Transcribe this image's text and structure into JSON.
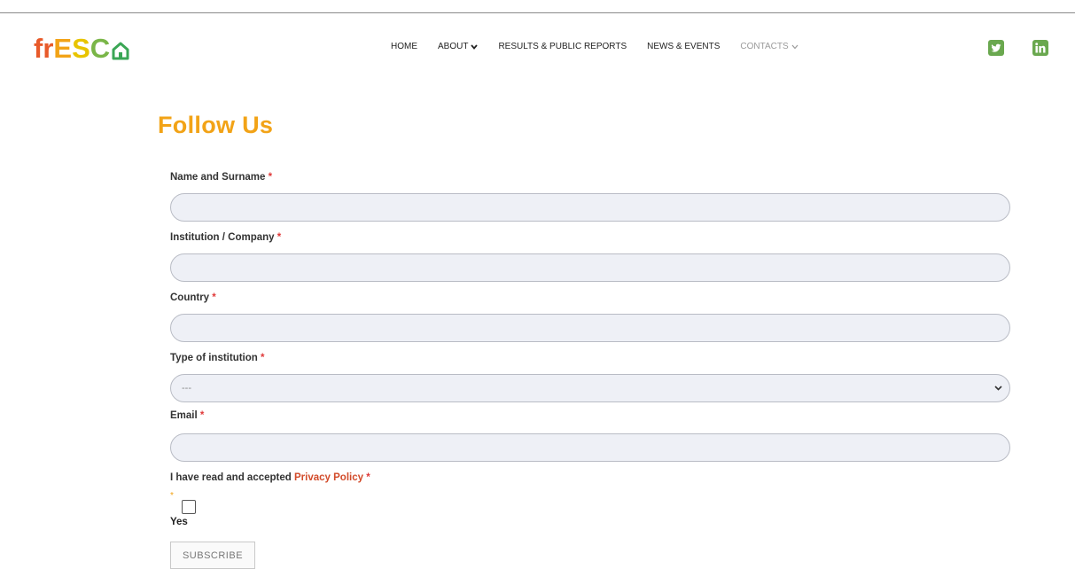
{
  "logo": {
    "letters": [
      "f",
      "r",
      "E",
      "S",
      "C"
    ],
    "colors": [
      "#e85a2a",
      "#e85a2a",
      "#f2a317",
      "#f2c200",
      "#7ab648",
      "#3aa655"
    ]
  },
  "nav": {
    "home": "HOME",
    "about": "ABOUT",
    "results": "RESULTS & PUBLIC REPORTS",
    "news": "NEWS & EVENTS",
    "contacts": "CONTACTS"
  },
  "social": {
    "twitter_icon": "twitter-icon",
    "linkedin_icon": "linkedin-icon",
    "color": "#6aa84f"
  },
  "page": {
    "title": "Follow Us",
    "title_color": "#f2a317"
  },
  "form": {
    "required_mark": "*",
    "name_label": "Name and Surname",
    "institution_label": "Institution / Company",
    "country_label": "Country",
    "type_label": "Type of institution",
    "type_selected": "---",
    "email_label": "Email",
    "privacy_prefix": "I have read and accepted",
    "privacy_link": "Privacy Policy",
    "option_star": "*",
    "yes_label": "Yes",
    "subscribe_label": "SUBSCRIBE"
  }
}
